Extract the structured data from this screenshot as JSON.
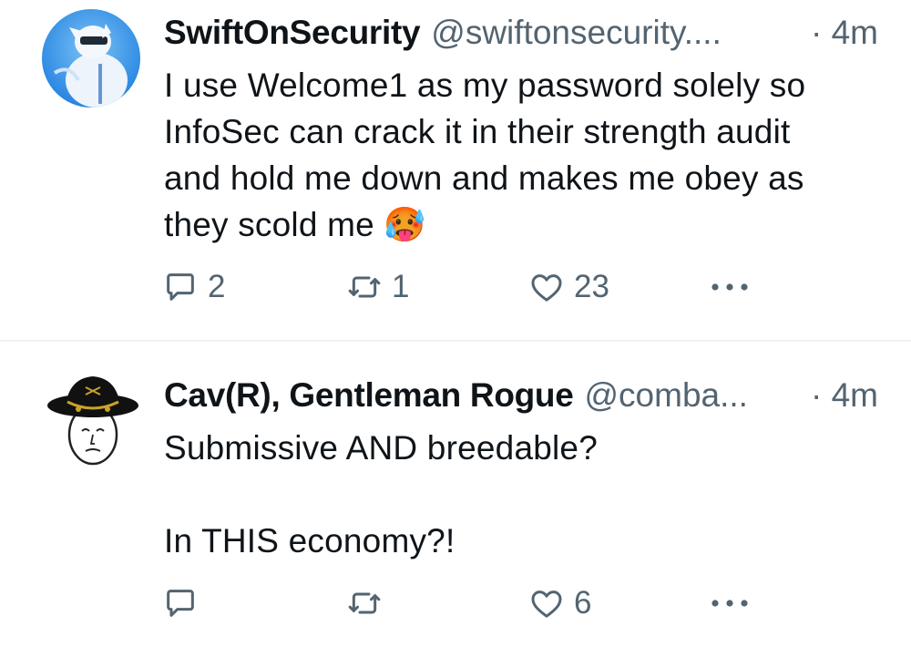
{
  "tweets": [
    {
      "display_name": "SwiftOnSecurity",
      "handle": "@swiftonsecurity....",
      "time": "· 4m",
      "text": "I use Welcome1 as my password solely so\nInfoSec can crack it in their strength audit\nand hold me down and makes me obey as\nthey scold me",
      "emoji": "🥵",
      "replies": "2",
      "retweets": "1",
      "likes": "23"
    },
    {
      "display_name": "Cav(R), Gentleman Rogue",
      "handle": "@comba...",
      "time": "· 4m",
      "text": "Submissive AND breedable?\n\nIn THIS economy?!",
      "replies": "",
      "retweets": "",
      "likes": "6"
    }
  ],
  "icons": {
    "reply": "reply-icon",
    "retweet": "retweet-icon",
    "like": "heart-icon",
    "more": "more-dots-icon"
  },
  "colors": {
    "text": "#0f1419",
    "secondary": "#536471",
    "divider": "#eff3f4",
    "avatar1_bg": "#2f8fe8"
  }
}
